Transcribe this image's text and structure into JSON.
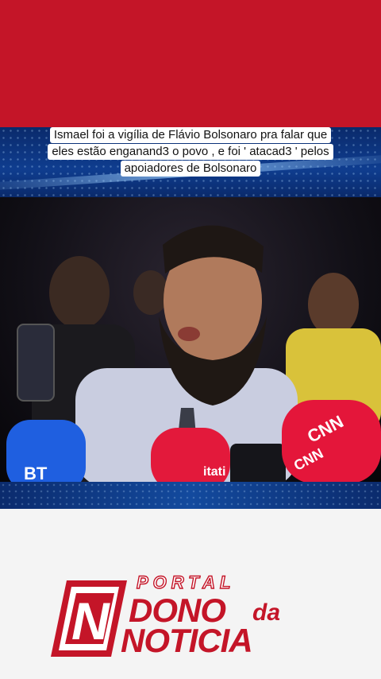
{
  "caption": {
    "line1": "Ismael foi a vigília de Flávio Bolsonaro pra falar que",
    "line2": "eles estão enganand3 o povo , e foi ' atacad3 ' pelos",
    "line3": "apoiadores de Bolsonaro"
  },
  "logo": {
    "letter": "N",
    "portal": "PORTAL",
    "dono": "DONO",
    "da": "da",
    "noticia": "NOTICIA"
  },
  "microphones": {
    "cnn_a": "CNN",
    "cnn_b": "CNN",
    "itatiaia": "itati",
    "left": "BT"
  },
  "colors": {
    "brand_red": "#c41528",
    "banner_blue": "#0f3d8f"
  }
}
